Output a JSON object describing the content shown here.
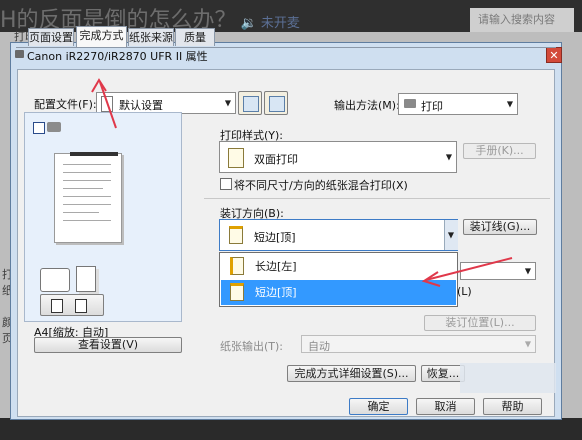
{
  "background": {
    "title": "H的反面是倒的怎么办？",
    "title_speaker": "🔉 未开麦",
    "search_placeholder": "请输入搜索内容",
    "left_fragments": [
      "打印机",
      "打",
      "纸",
      "颜",
      "页"
    ]
  },
  "dialog": {
    "title": "Canon iR2270/iR2870 UFR II 属性",
    "close_label": "✕",
    "tabs": [
      {
        "label": "页面设置",
        "active": false
      },
      {
        "label": "完成方式",
        "active": true
      },
      {
        "label": "纸张来源",
        "active": false
      },
      {
        "label": "质量",
        "active": false
      }
    ],
    "profile_label": "配置文件(F):",
    "profile_value": "默认设置",
    "output_method_label": "输出方法(M):",
    "output_method_value": "打印",
    "preview": {
      "size_text": "A4[缩放: 自动]",
      "view_settings_button": "查看设置(V)"
    },
    "print_style_label": "打印样式(Y):",
    "print_style_value": "双面打印",
    "manual_button": "手册(K)...",
    "mixed_checkbox_label": "将不同尺寸/方向的纸张混合打印(X)",
    "binding_direction_label": "装订方向(B):",
    "binding_direction_value": "短边[顶]",
    "gutter_button": "装订线(G)...",
    "binding_options": [
      {
        "label": "长边[左]",
        "selected": false
      },
      {
        "label": "短边[顶]",
        "selected": true
      }
    ],
    "binding_position_button": "装订位置(L)...",
    "hidden_fragment": "(L)",
    "paper_output_label": "纸张输出(T):",
    "paper_output_value": "自动",
    "advanced_button": "完成方式详细设置(S)...",
    "partial_button": "恢复...",
    "ok_button": "确定",
    "cancel_button": "取消",
    "help_button": "帮助"
  },
  "colors": {
    "selection": "#3399ff",
    "annotation_arrow": "#e0384a"
  }
}
